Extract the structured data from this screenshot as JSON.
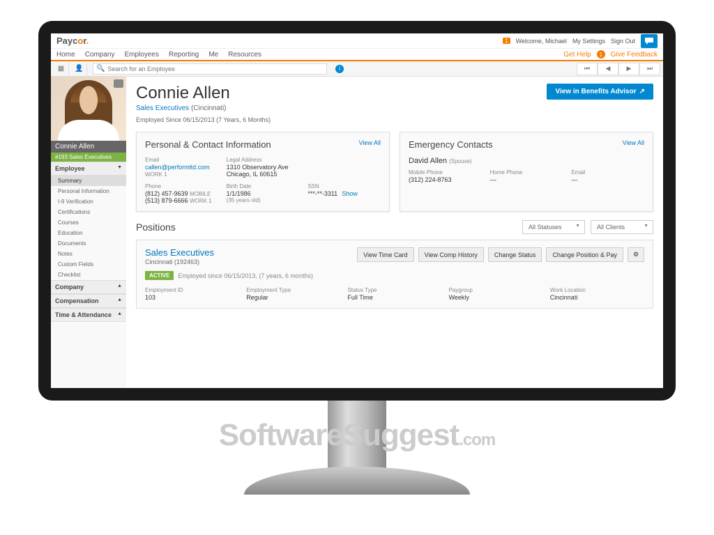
{
  "brand": {
    "name": "Paycor",
    "name_pre": "Payc",
    "name_accent": "o",
    "name_post": "r"
  },
  "top": {
    "welcome_badge": "1",
    "welcome": "Welcome, Michael",
    "settings": "My Settings",
    "signout": "Sign Out"
  },
  "menu": {
    "home": "Home",
    "company": "Company",
    "employees": "Employees",
    "reporting": "Reporting",
    "me": "Me",
    "resources": "Resources",
    "gethelp": "Get Help",
    "help_count": "1",
    "feedback": "Give Feedback"
  },
  "search": {
    "placeholder": "Search for an Employee"
  },
  "sidebar": {
    "name": "Connie Allen",
    "dept": "#193 Sales Executives",
    "sections": {
      "employee": "Employee",
      "items": [
        "Summary",
        "Personal Information",
        "I-9 Verification",
        "Certifications",
        "Courses",
        "Education",
        "Documents",
        "Notes",
        "Custom Fields",
        "Checklist"
      ],
      "company": "Company",
      "compensation": "Compensation",
      "time": "Time & Attendance"
    }
  },
  "employee": {
    "name": "Connie Allen",
    "department": "Sales Executives",
    "location": "(Cincinnati)",
    "since": "Employed Since 06/15/2013 (7 Years, 6 Months)",
    "benefits_btn": "View in Benefits Advisor"
  },
  "personal": {
    "title": "Personal & Contact Information",
    "viewall": "View All",
    "email_label": "Email",
    "email": "callen@performltd.com",
    "email_tag": "WORK 1",
    "address_label": "Legal Address",
    "address1": "1310 Observatory Ave",
    "address2": "Chicago, IL 60615",
    "phone_label": "Phone",
    "phone1": "(812) 457-9639",
    "phone1_tag": "MOBILE",
    "phone2": "(513) 879-6666",
    "phone2_tag": "WORK 1",
    "birth_label": "Birth Date",
    "birth": "1/1/1986",
    "birth_age": "(35 years old)",
    "ssn_label": "SSN",
    "ssn": "***-**-3311",
    "show": "Show"
  },
  "emergency": {
    "title": "Emergency Contacts",
    "viewall": "View All",
    "name": "David Allen",
    "rel": "(Spouse)",
    "mobile_label": "Mobile Phone",
    "mobile": "(312) 224-8763",
    "home_label": "Home Phone",
    "home": "—",
    "email_label": "Email",
    "email": "—"
  },
  "positions": {
    "title": "Positions",
    "filter_status": "All Statuses",
    "filter_clients": "All Clients",
    "job_title": "Sales Executives",
    "job_loc": "Cincinnati (192463)",
    "btn_timecard": "View Time Card",
    "btn_comp": "View Comp History",
    "btn_status": "Change Status",
    "btn_change": "Change Position & Pay",
    "active": "ACTIVE",
    "since": "Employed since 06/15/2013, (7 years, 6 months)",
    "cols": {
      "empid_label": "Employment ID",
      "empid": "103",
      "type_label": "Employment Type",
      "type": "Regular",
      "status_label": "Status Type",
      "status": "Full Time",
      "paygroup_label": "Paygroup",
      "paygroup": "Weekly",
      "workloc_label": "Work Location",
      "workloc": "Cincinnati"
    }
  }
}
